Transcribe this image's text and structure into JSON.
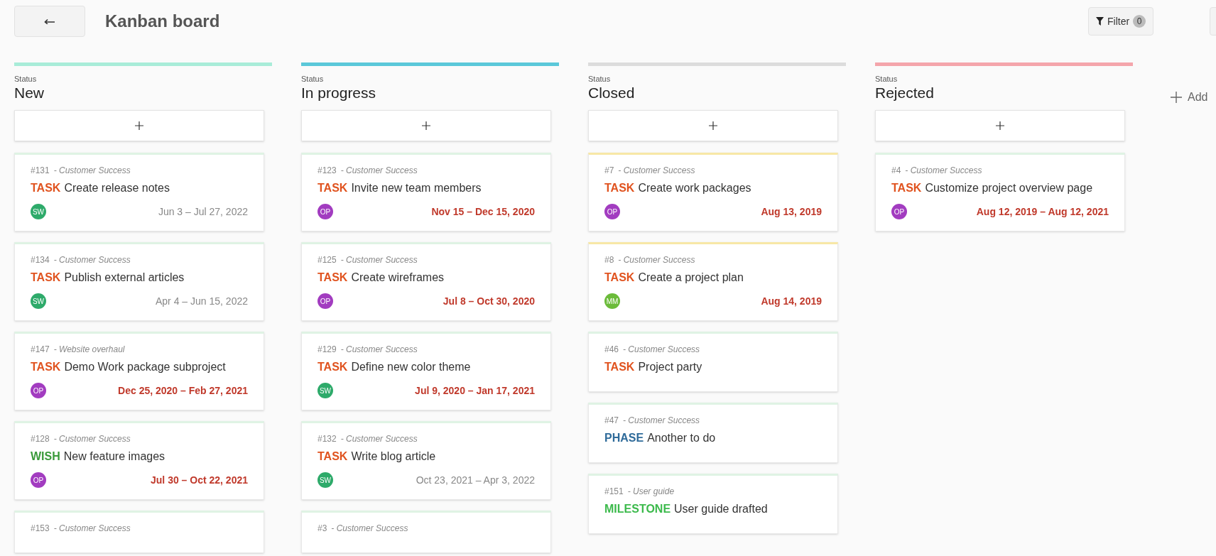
{
  "header": {
    "title": "Kanban board",
    "filter": {
      "label": "Filter",
      "count": "0"
    }
  },
  "columns": [
    {
      "label": "Status",
      "name": "New",
      "color": "#a8ecd8",
      "cards": [
        {
          "id": "#131",
          "project": "- Customer Success",
          "type": {
            "label": "TASK",
            "color": "#e0531f"
          },
          "subject": "Create release notes",
          "color": "#dff3e4",
          "avatar": {
            "initials": "SW",
            "color": "#2eaa6a"
          },
          "dates": "Jun 3 – Jul 27, 2022",
          "overdue": false
        },
        {
          "id": "#134",
          "project": "- Customer Success",
          "type": {
            "label": "TASK",
            "color": "#e0531f"
          },
          "subject": "Publish external articles",
          "color": "#dff3e4",
          "avatar": {
            "initials": "SW",
            "color": "#2eaa6a"
          },
          "dates": "Apr 4 – Jun 15, 2022",
          "overdue": false
        },
        {
          "id": "#147",
          "project": "- Website overhaul",
          "type": {
            "label": "TASK",
            "color": "#e0531f"
          },
          "subject": "Demo Work package subproject",
          "color": "#dff3e4",
          "avatar": {
            "initials": "OP",
            "color": "#a23cc0"
          },
          "dates": "Dec 25, 2020 – Feb 27, 2021",
          "overdue": true
        },
        {
          "id": "#128",
          "project": "- Customer Success",
          "type": {
            "label": "WISH",
            "color": "#3a9a3a"
          },
          "subject": "New feature images",
          "color": "#dff3e4",
          "avatar": {
            "initials": "OP",
            "color": "#a23cc0"
          },
          "dates": "Jul 30 – Oct 22, 2021",
          "overdue": true
        },
        {
          "id": "#153",
          "project": "- Customer Success",
          "color": "#dff3e4"
        }
      ]
    },
    {
      "label": "Status",
      "name": "In progress",
      "color": "#5bc8d9",
      "cards": [
        {
          "id": "#123",
          "project": "- Customer Success",
          "type": {
            "label": "TASK",
            "color": "#e0531f"
          },
          "subject": "Invite new team members",
          "color": "#dff3e4",
          "avatar": {
            "initials": "OP",
            "color": "#a23cc0"
          },
          "dates": "Nov 15 – Dec 15, 2020",
          "overdue": true
        },
        {
          "id": "#125",
          "project": "- Customer Success",
          "type": {
            "label": "TASK",
            "color": "#e0531f"
          },
          "subject": "Create wireframes",
          "color": "#dff3e4",
          "avatar": {
            "initials": "OP",
            "color": "#a23cc0"
          },
          "dates": "Jul 8 – Oct 30, 2020",
          "overdue": true
        },
        {
          "id": "#129",
          "project": "- Customer Success",
          "type": {
            "label": "TASK",
            "color": "#e0531f"
          },
          "subject": "Define new color theme",
          "color": "#dff3e4",
          "avatar": {
            "initials": "SW",
            "color": "#2eaa6a"
          },
          "dates": "Jul 9, 2020 – Jan 17, 2021",
          "overdue": true
        },
        {
          "id": "#132",
          "project": "- Customer Success",
          "type": {
            "label": "TASK",
            "color": "#e0531f"
          },
          "subject": "Write blog article",
          "color": "#dff3e4",
          "avatar": {
            "initials": "SW",
            "color": "#2eaa6a"
          },
          "dates": "Oct 23, 2021 – Apr 3, 2022",
          "overdue": false
        },
        {
          "id": "#3",
          "project": "- Customer Success",
          "color": "#dff3e4"
        }
      ]
    },
    {
      "label": "Status",
      "name": "Closed",
      "color": "#dcdcdc",
      "cards": [
        {
          "id": "#7",
          "project": "- Customer Success",
          "type": {
            "label": "TASK",
            "color": "#e0531f"
          },
          "subject": "Create work packages",
          "color": "#f7e7a6",
          "avatar": {
            "initials": "OP",
            "color": "#a23cc0"
          },
          "dates": "Aug 13, 2019",
          "overdue": true
        },
        {
          "id": "#8",
          "project": "- Customer Success",
          "type": {
            "label": "TASK",
            "color": "#e0531f"
          },
          "subject": "Create a project plan",
          "color": "#f7e7a6",
          "avatar": {
            "initials": "MM",
            "color": "#6bbb3a"
          },
          "dates": "Aug 14, 2019",
          "overdue": true
        },
        {
          "id": "#46",
          "project": "- Customer Success",
          "type": {
            "label": "TASK",
            "color": "#e0531f"
          },
          "subject": "Project party",
          "color": "#dff3e4"
        },
        {
          "id": "#47",
          "project": "- Customer Success",
          "type": {
            "label": "PHASE",
            "color": "#2f6b9a"
          },
          "subject": "Another to do",
          "color": "#dff3e4"
        },
        {
          "id": "#151",
          "project": "- User guide",
          "type": {
            "label": "MILESTONE",
            "color": "#3cba4c"
          },
          "subject": "User guide drafted",
          "color": "#dff3e4"
        }
      ]
    },
    {
      "label": "Status",
      "name": "Rejected",
      "color": "#f4a5ab",
      "cards": [
        {
          "id": "#4",
          "project": "- Customer Success",
          "type": {
            "label": "TASK",
            "color": "#e0531f"
          },
          "subject": "Customize project overview page",
          "color": "#dff3e4",
          "avatar": {
            "initials": "OP",
            "color": "#a23cc0"
          },
          "dates": "Aug 12, 2019 – Aug 12, 2021",
          "overdue": true
        }
      ]
    }
  ],
  "add_column": {
    "label": "Add"
  }
}
